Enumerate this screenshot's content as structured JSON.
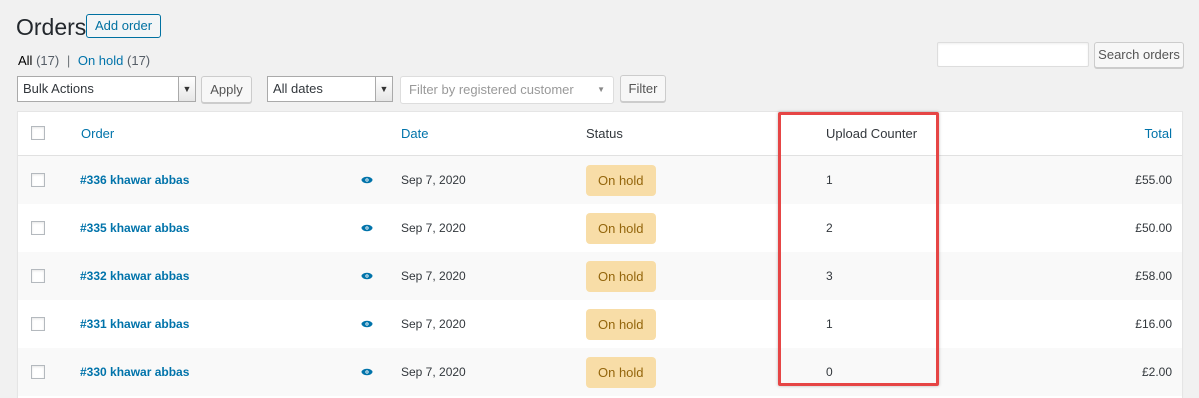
{
  "page": {
    "title": "Orders",
    "add_order_label": "Add order"
  },
  "views": {
    "all_label": "All",
    "all_count": "(17)",
    "separator": "|",
    "on_hold_label": "On hold",
    "on_hold_count": "(17)"
  },
  "search": {
    "value": "",
    "button_label": "Search orders"
  },
  "filters": {
    "bulk_actions": "Bulk Actions",
    "apply_label": "Apply",
    "dates": "All dates",
    "customer_placeholder": "Filter by registered customer",
    "filter_label": "Filter"
  },
  "table": {
    "columns": {
      "order": "Order",
      "date": "Date",
      "status": "Status",
      "upload_counter": "Upload Counter",
      "total": "Total"
    },
    "rows": [
      {
        "order": "#336 khawar abbas",
        "date": "Sep 7, 2020",
        "status": "On hold",
        "upload_counter": "1",
        "total": "£55.00"
      },
      {
        "order": "#335 khawar abbas",
        "date": "Sep 7, 2020",
        "status": "On hold",
        "upload_counter": "2",
        "total": "£50.00"
      },
      {
        "order": "#332 khawar abbas",
        "date": "Sep 7, 2020",
        "status": "On hold",
        "upload_counter": "3",
        "total": "£58.00"
      },
      {
        "order": "#331 khawar abbas",
        "date": "Sep 7, 2020",
        "status": "On hold",
        "upload_counter": "1",
        "total": "£16.00"
      },
      {
        "order": "#330 khawar abbas",
        "date": "Sep 7, 2020",
        "status": "On hold",
        "upload_counter": "0",
        "total": "£2.00"
      }
    ]
  },
  "colors": {
    "link": "#0073aa",
    "status_on_hold_bg": "#f8dda7",
    "status_on_hold_text": "#94660c",
    "highlight": "#e64545"
  },
  "icons": {
    "preview": "eye-icon"
  }
}
